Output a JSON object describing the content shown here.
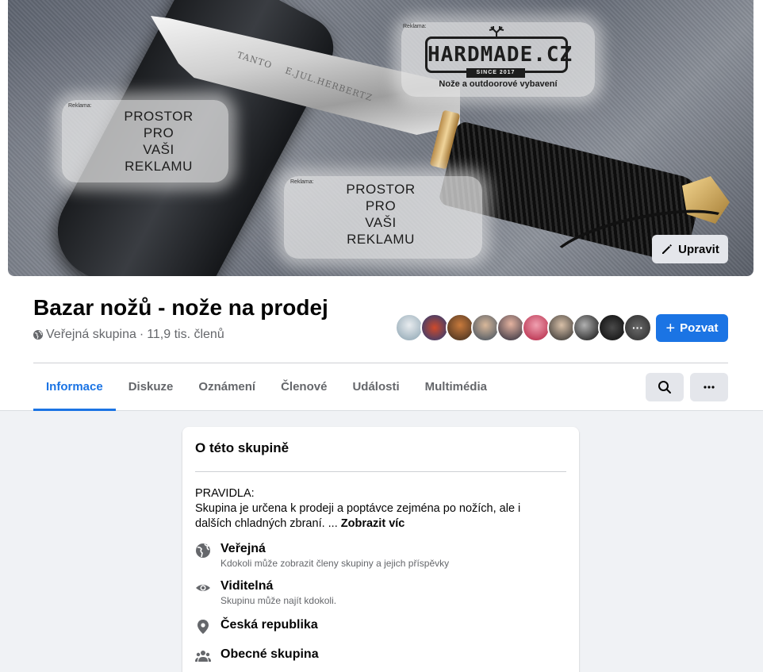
{
  "cover": {
    "blade_text_1": "TANTO",
    "blade_text_2": "E.JUL.HERBERTZ",
    "ad_label": "Reklama:",
    "ad_space_lines": [
      "PROSTOR",
      "PRO",
      "VAŠI",
      "REKLAMU"
    ],
    "logo_text": "HARDMADE.CZ",
    "logo_since": "SINCE 2017",
    "logo_tagline": "Nože a outdoorové vybavení",
    "edit_label": "Upravit"
  },
  "header": {
    "title": "Bazar nožů - nože na prodej",
    "privacy": "Veřejná skupina",
    "separator": "·",
    "members": "11,9 tis. členů",
    "invite_label": "Pozvat",
    "more_avatars": "···"
  },
  "tabs": [
    "Informace",
    "Diskuze",
    "Oznámení",
    "Členové",
    "Události",
    "Multimédia"
  ],
  "about": {
    "title": "O této skupině",
    "rules_heading": "PRAVIDLA:",
    "rules_text": "Skupina je určena k prodeji a poptávce zejména po nožích, ale i dalších chladných zbraní. ...",
    "show_more": "Zobrazit víc",
    "items": [
      {
        "title": "Veřejná",
        "subtitle": "Kdokoli může zobrazit členy skupiny a jejich příspěvky",
        "icon": "globe-icon"
      },
      {
        "title": "Viditelná",
        "subtitle": "Skupinu může najít kdokoli.",
        "icon": "eye-icon"
      },
      {
        "title": "Česká republika",
        "subtitle": "",
        "icon": "location-pin-icon"
      },
      {
        "title": "Obecné skupina",
        "subtitle": "",
        "icon": "group-icon"
      }
    ]
  },
  "colors": {
    "accent": "#1b74e4",
    "text_primary": "#050505",
    "text_secondary": "#65676b",
    "page_bg": "#f0f2f5"
  }
}
